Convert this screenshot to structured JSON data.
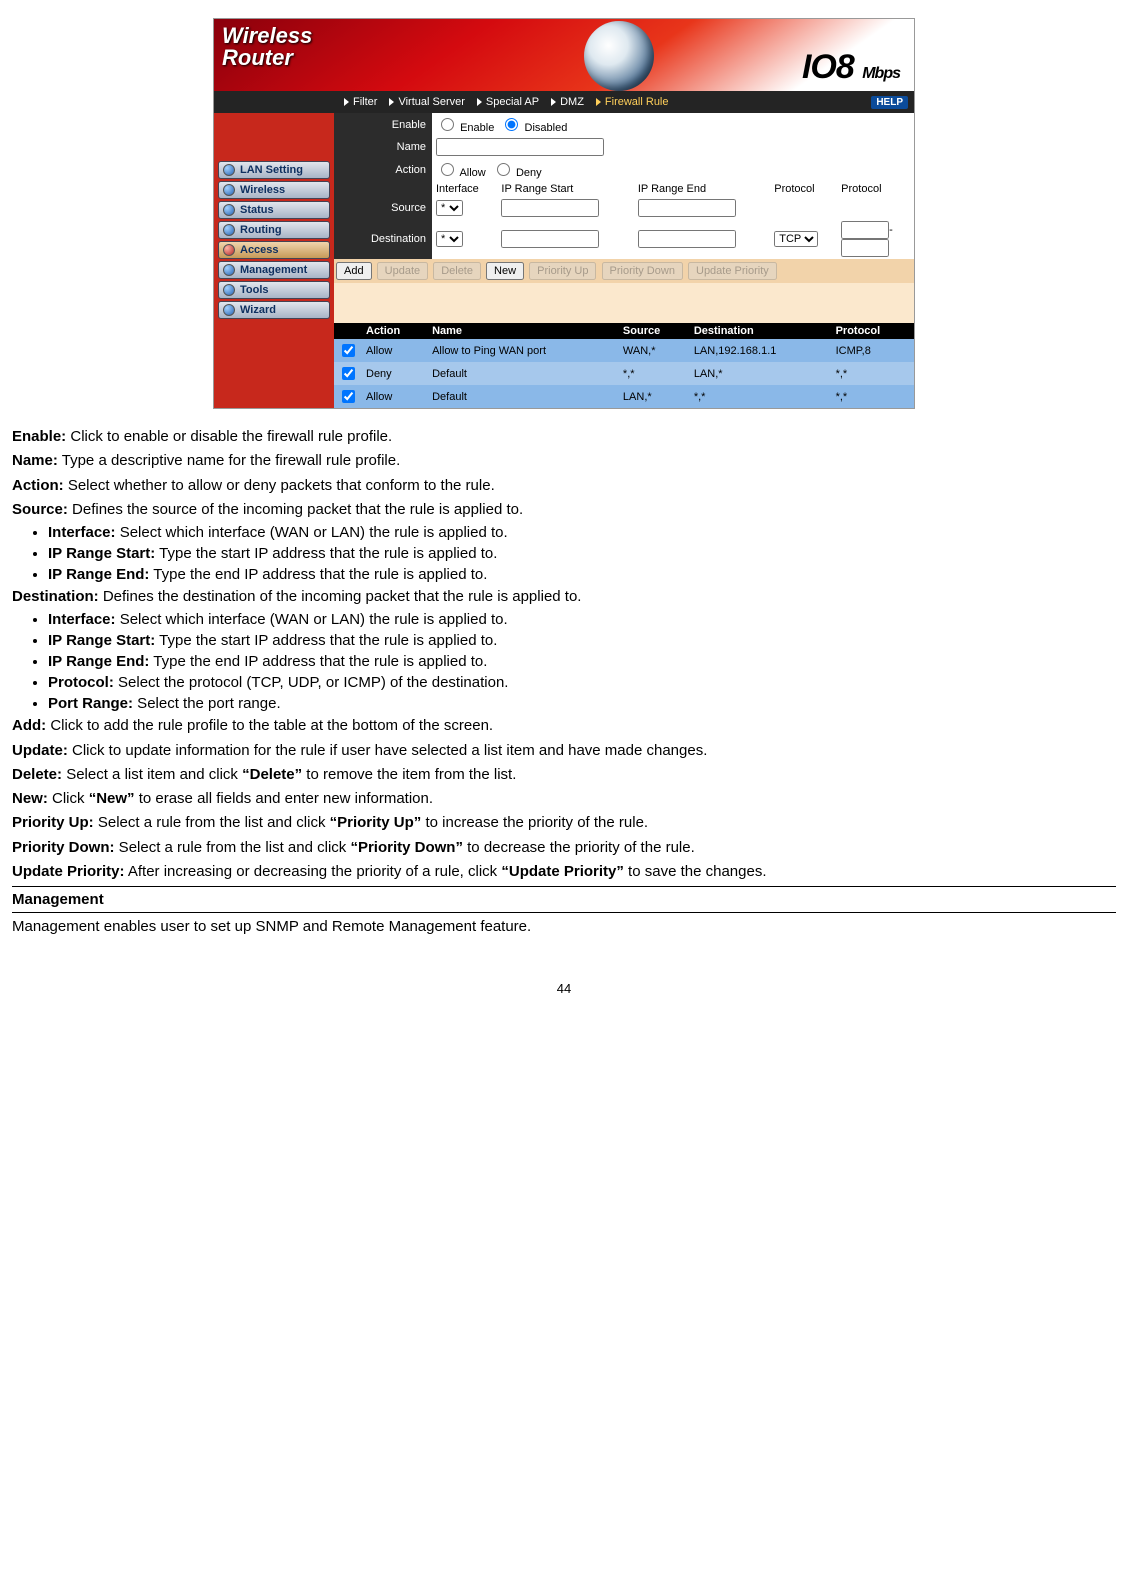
{
  "router_ui": {
    "brand_line1": "Wireless",
    "brand_line2": "Router",
    "mbps_big": "IO8",
    "mbps_small": "Mbps",
    "help": "HELP",
    "tabs": [
      {
        "label": "Filter",
        "active": false
      },
      {
        "label": "Virtual Server",
        "active": false
      },
      {
        "label": "Special AP",
        "active": false
      },
      {
        "label": "DMZ",
        "active": false
      },
      {
        "label": "Firewall Rule",
        "active": true
      }
    ],
    "side_items": [
      {
        "label": "LAN Setting",
        "active": false
      },
      {
        "label": "Wireless",
        "active": false
      },
      {
        "label": "Status",
        "active": false
      },
      {
        "label": "Routing",
        "active": false
      },
      {
        "label": "Access",
        "active": true
      },
      {
        "label": "Management",
        "active": false
      },
      {
        "label": "Tools",
        "active": false
      },
      {
        "label": "Wizard",
        "active": false
      }
    ],
    "form": {
      "enable_label": "Enable",
      "enable_opt1": "Enable",
      "enable_opt2": "Disabled",
      "name_label": "Name",
      "action_label": "Action",
      "action_opt1": "Allow",
      "action_opt2": "Deny",
      "col_interface": "Interface",
      "col_ipstart": "IP Range Start",
      "col_ipend": "IP Range End",
      "col_protocol": "Protocol",
      "source_label": "Source",
      "dest_label": "Destination",
      "source_if": "*",
      "dest_if": "*",
      "dest_proto": "TCP",
      "port_dash": "-"
    },
    "buttons": {
      "add": "Add",
      "update": "Update",
      "delete": "Delete",
      "new": "New",
      "pup": "Priority Up",
      "pdown": "Priority Down",
      "upprio": "Update Priority"
    },
    "rules": {
      "headers": [
        "Action",
        "Name",
        "Source",
        "Destination",
        "Protocol"
      ],
      "rows": [
        {
          "action": "Allow",
          "name": "Allow to Ping WAN port",
          "source": "WAN,*",
          "dest": "LAN,192.168.1.1",
          "proto": "ICMP,8"
        },
        {
          "action": "Deny",
          "name": "Default",
          "source": "*,*",
          "dest": "LAN,*",
          "proto": "*,*"
        },
        {
          "action": "Allow",
          "name": "Default",
          "source": "LAN,*",
          "dest": "*,*",
          "proto": "*,*"
        }
      ]
    }
  },
  "doc": {
    "enable": {
      "t": "Enable:",
      "d": " Click to enable or disable the firewall rule profile."
    },
    "name": {
      "t": "Name:",
      "d": " Type a descriptive name for the firewall rule profile."
    },
    "action": {
      "t": "Action:",
      "d": " Select whether to allow or deny packets that conform to the rule."
    },
    "source": {
      "t": "Source:",
      "d": " Defines the source of the incoming packet that the rule is applied to."
    },
    "src_items": [
      {
        "t": "Interface:",
        "d": " Select which interface (WAN or LAN) the rule is applied to."
      },
      {
        "t": "IP Range Start:",
        "d": " Type the start IP address that the rule is applied to."
      },
      {
        "t": "IP Range End:",
        "d": " Type the end IP address that the rule is applied to."
      }
    ],
    "destination": {
      "t": "Destination:",
      "d": " Defines the destination of the incoming packet that the rule is applied to."
    },
    "dst_items": [
      {
        "t": "Interface:",
        "d": " Select which interface (WAN or LAN) the rule is applied to."
      },
      {
        "t": "IP Range Start:",
        "d": " Type the start IP address that the rule is applied to."
      },
      {
        "t": "IP Range End:",
        "d": " Type the end IP address that the rule is applied to."
      },
      {
        "t": "Protocol:",
        "d": " Select the protocol (TCP, UDP, or ICMP) of the destination."
      },
      {
        "t": "Port Range:",
        "d": " Select the port range."
      }
    ],
    "add": {
      "t": "Add:",
      "d": " Click to add the rule profile to the table at the bottom of the screen."
    },
    "update": {
      "t": "Update:",
      "d": " Click to update information for the rule if user have selected a list item and have made changes."
    },
    "delete_pre": "Delete:",
    "delete_mid": " Select a list item and click ",
    "delete_q": "“Delete”",
    "delete_post": " to remove the item from the list.",
    "new_pre": "New:",
    "new_mid": " Click ",
    "new_q": "“New”",
    "new_post": " to erase all fields and enter new information.",
    "pup_pre": "Priority Up:",
    "pup_mid": " Select a rule from the list and click ",
    "pup_q": "“Priority Up”",
    "pup_post": " to increase the priority of the rule.",
    "pdown_pre": "Priority Down:",
    "pdown_mid": " Select a rule from the list and click ",
    "pdown_q": "“Priority Down”",
    "pdown_post": " to decrease the priority of the rule.",
    "upp_pre": "Update Priority:",
    "upp_mid": " After increasing or decreasing the priority of a rule, click ",
    "upp_q": "“Update Priority”",
    "upp_post": " to save the changes.",
    "mgmt_head": "Management",
    "mgmt_body": "Management enables user to set up SNMP and Remote Management feature.",
    "page": "44"
  }
}
